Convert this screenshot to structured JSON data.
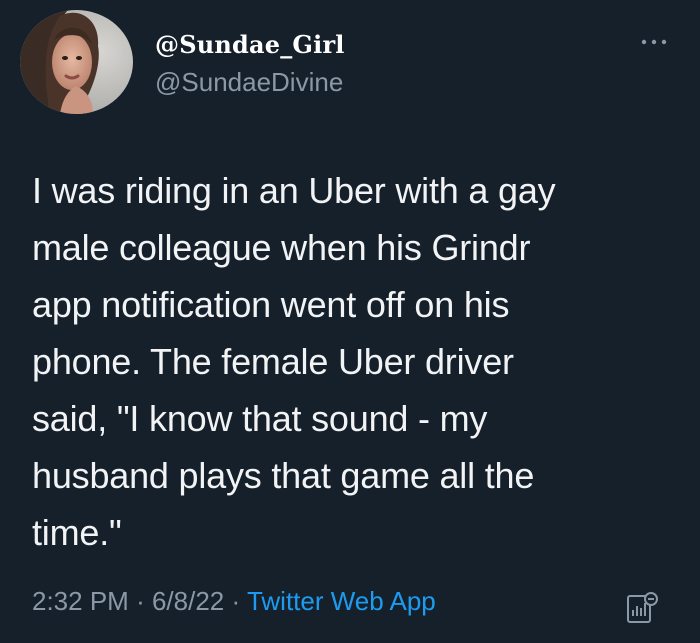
{
  "tweet": {
    "author": {
      "display_name": "@Sundae_Girl",
      "handle": "@SundaeDivine",
      "avatar_icon": "avatar-photo"
    },
    "text_lines": [
      "I was riding in an Uber with a gay",
      "male colleague when his Grindr",
      "app notification went off on his",
      "phone. The female Uber driver",
      "said, \"I know that sound - my",
      "husband plays that game all the",
      "time.\""
    ],
    "time": "2:32 PM",
    "separator": "·",
    "date": "6/8/22",
    "source": "Twitter Web App",
    "icons": {
      "more": "more-horizontal-icon",
      "analytics": "analytics-icon"
    }
  },
  "colors": {
    "background": "#16202b",
    "text": "#f2f3f4",
    "secondary": "#8b98a5",
    "link": "#1d9bf0"
  }
}
